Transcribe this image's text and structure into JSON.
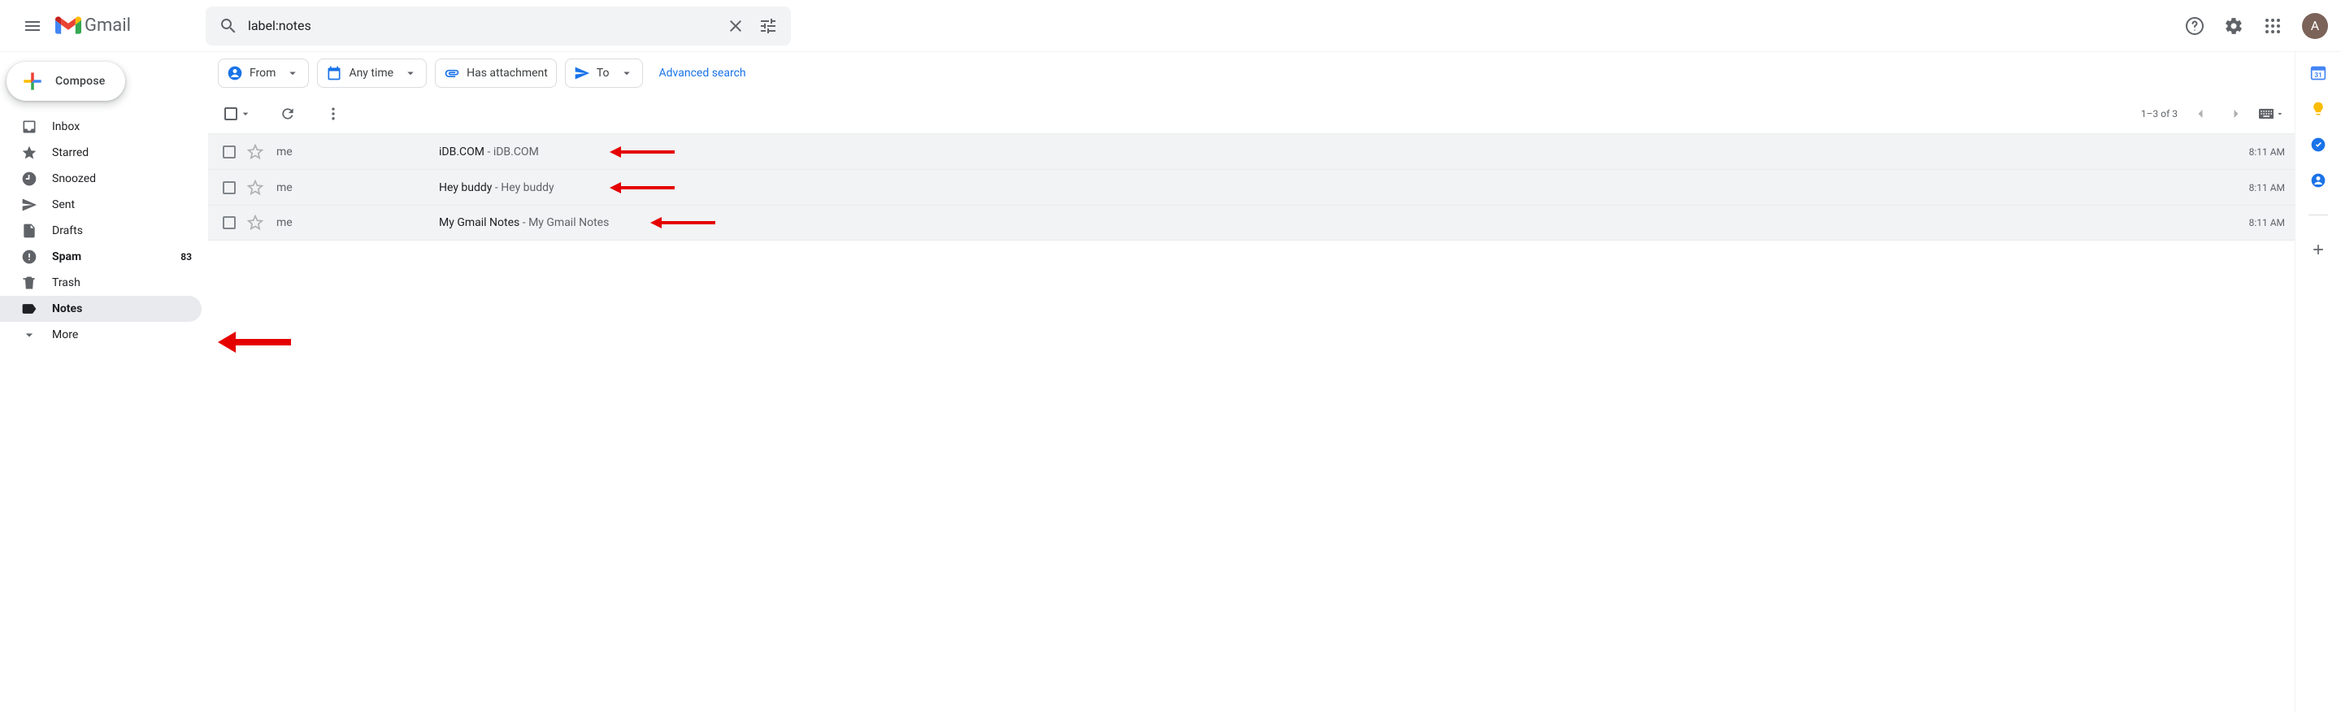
{
  "header": {
    "app_name": "Gmail",
    "search_value": "label:notes",
    "avatar_initial": "A"
  },
  "sidebar": {
    "compose_label": "Compose",
    "items": [
      {
        "label": "Inbox",
        "count": ""
      },
      {
        "label": "Starred",
        "count": ""
      },
      {
        "label": "Snoozed",
        "count": ""
      },
      {
        "label": "Sent",
        "count": ""
      },
      {
        "label": "Drafts",
        "count": ""
      },
      {
        "label": "Spam",
        "count": "83"
      },
      {
        "label": "Trash",
        "count": ""
      },
      {
        "label": "Notes",
        "count": ""
      },
      {
        "label": "More",
        "count": ""
      }
    ]
  },
  "filters": {
    "from": "From",
    "time": "Any time",
    "attach": "Has attachment",
    "to": "To",
    "advanced": "Advanced search"
  },
  "toolbar": {
    "count_text": "1–3 of 3"
  },
  "emails": [
    {
      "sender": "me",
      "subject": "iDB.COM",
      "snippet": "iDB.COM",
      "time": "8:11 AM"
    },
    {
      "sender": "me",
      "subject": "Hey buddy",
      "snippet": "Hey buddy",
      "time": "8:11 AM"
    },
    {
      "sender": "me",
      "subject": "My Gmail Notes",
      "snippet": "My Gmail Notes",
      "time": "8:11 AM"
    }
  ]
}
